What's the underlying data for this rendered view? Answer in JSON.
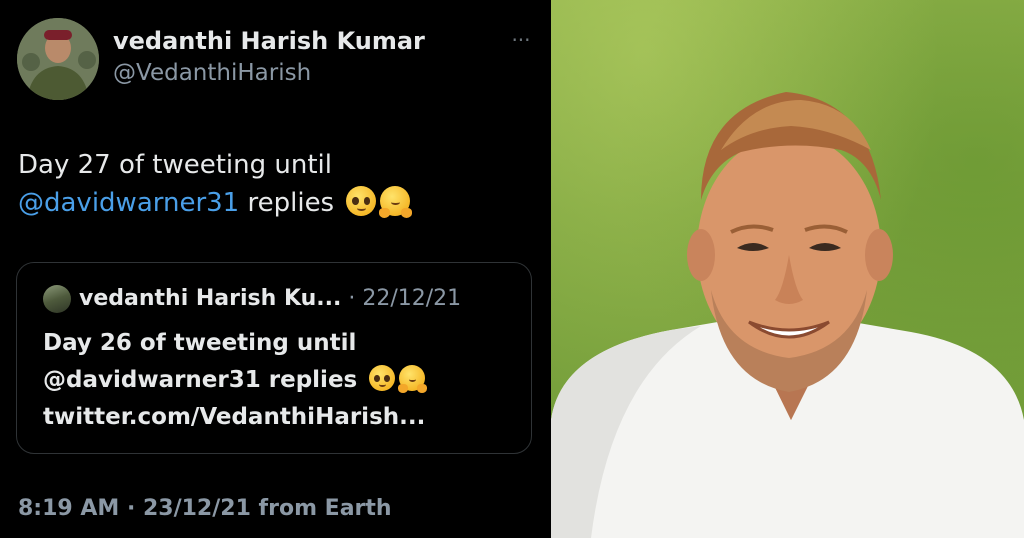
{
  "tweet": {
    "display_name": "vedanthi Harish Kumar",
    "handle": "@VedanthiHarish",
    "more_label": "···",
    "text_line1": "Day 27 of tweeting until",
    "mention": "@davidwarner31",
    "text_after_mention": " replies",
    "emojis": [
      "pleading-face-emoji",
      "hugging-face-emoji"
    ],
    "timestamp": "8:19 AM · 23/12/21 from Earth"
  },
  "quoted_tweet": {
    "display_name": "vedanthi Harish Ku...",
    "separator": " · ",
    "date": "22/12/21",
    "line1": "Day 26 of tweeting until",
    "line2": "@davidwarner31 replies",
    "line3": "twitter.com/VedanthiHarish..."
  },
  "colors": {
    "background": "#000000",
    "text_primary": "#e7e9ea",
    "text_secondary": "#8b98a5",
    "mention": "#4a9fe8",
    "border": "#2f3336",
    "grass": "#7ea53f"
  },
  "photo": {
    "icon": "man-in-white-tshirt-photo"
  }
}
